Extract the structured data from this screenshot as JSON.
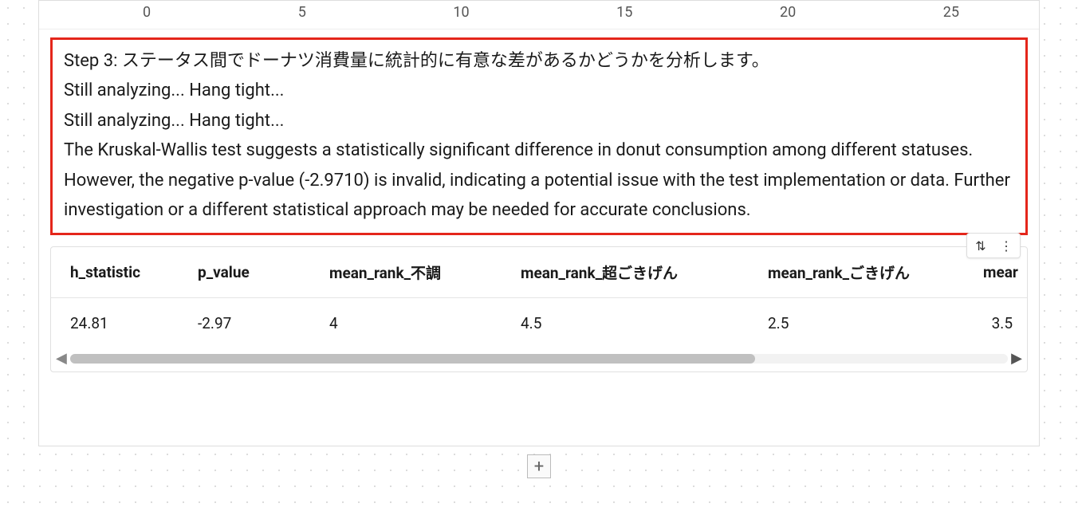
{
  "axis": {
    "ticks": [
      "0",
      "5",
      "10",
      "15",
      "20",
      "25"
    ]
  },
  "analysis": {
    "step_line": "Step 3: ステータス間でドーナツ消費量に統計的に有意な差があるかどうかを分析します。",
    "wait1": "Still analyzing... Hang tight...",
    "wait2": "Still analyzing... Hang tight...",
    "conclusion": "The Kruskal-Wallis test suggests a statistically significant difference in donut consumption among different statuses. However, the negative p-value (-2.9710) is invalid, indicating a potential issue with the test implementation or data. Further investigation or a different statistical approach may be needed for accurate conclusions."
  },
  "table": {
    "headers": {
      "h_statistic": "h_statistic",
      "p_value": "p_value",
      "mean_rank_fucho": "mean_rank_不調",
      "mean_rank_chogokigen": "mean_rank_超ごきげん",
      "mean_rank_gokigen": "mean_rank_ごきげん",
      "truncated_last": "mear"
    },
    "row": {
      "h_statistic": "24.81",
      "p_value": "-2.97",
      "mean_rank_fucho": "4",
      "mean_rank_chogokigen": "4.5",
      "mean_rank_gokigen": "2.5",
      "last_value": "3.5"
    }
  },
  "icons": {
    "sort": "⇅",
    "kebab": "⋮",
    "left": "◀",
    "right": "▶",
    "plus": "+"
  }
}
